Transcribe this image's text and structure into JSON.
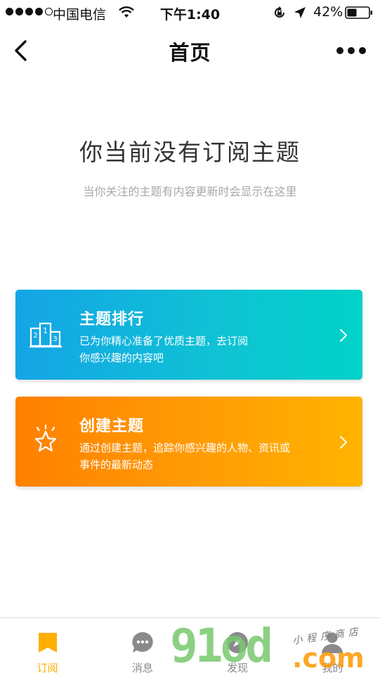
{
  "status_bar": {
    "carrier": "中国电信",
    "time": "下午1:40",
    "battery": "42%",
    "icons": [
      "signal-dots",
      "wifi-icon",
      "rotation-lock-icon",
      "location-arrow-icon",
      "battery-icon"
    ]
  },
  "nav": {
    "title": "首页",
    "icons": [
      "back-chevron-icon",
      "more-dots-icon"
    ]
  },
  "empty_state": {
    "title": "你当前没有订阅主题",
    "subtitle": "当你关注的主题有内容更新时会显示在这里"
  },
  "cards": [
    {
      "title": "主题排行",
      "desc_line1": "已为你精心准备了优质主题，去订阅",
      "desc_line2": "你感兴趣的内容吧",
      "icon": "podium-icon",
      "color": "#14a4e6"
    },
    {
      "title": "创建主题",
      "desc_line1": "通过创建主题，追踪你感兴趣的人物、资讯或",
      "desc_line2": "事件的最新动态",
      "icon": "star-icon",
      "color": "#ff8a00"
    }
  ],
  "tabs": [
    {
      "label": "订阅",
      "icon": "bookmark-icon",
      "active": true
    },
    {
      "label": "消息",
      "icon": "chat-bubble-icon",
      "active": false
    },
    {
      "label": "发现",
      "icon": "compass-icon",
      "active": false
    },
    {
      "label": "我的",
      "icon": "user-icon",
      "active": false
    }
  ],
  "colors": {
    "accent": "#ffae00",
    "inactive": "#8a8a8a"
  },
  "watermark": {
    "big": "91od",
    "com": ".com",
    "small": "小程序商店"
  }
}
